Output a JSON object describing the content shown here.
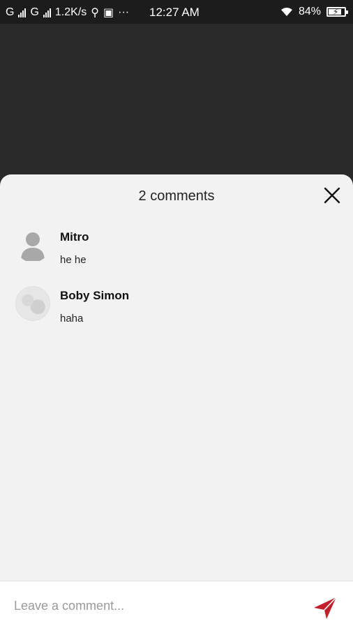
{
  "status_bar": {
    "carrier1": "G",
    "carrier2": "G",
    "speed": "1.2K/s",
    "time": "12:27 AM",
    "battery": "84%",
    "battery_level": 0.84
  },
  "sheet": {
    "title": "2 comments"
  },
  "comments": [
    {
      "name": "Mitro",
      "text": "he he",
      "avatar": "default-avatar"
    },
    {
      "name": "Boby Simon",
      "text": "haha",
      "avatar": "photo-avatar"
    }
  ],
  "input": {
    "placeholder": "Leave a comment..."
  },
  "colors": {
    "send_icon": "#c0202a",
    "backdrop": "#2a2a2a",
    "sheet": "#f2f2f2"
  }
}
